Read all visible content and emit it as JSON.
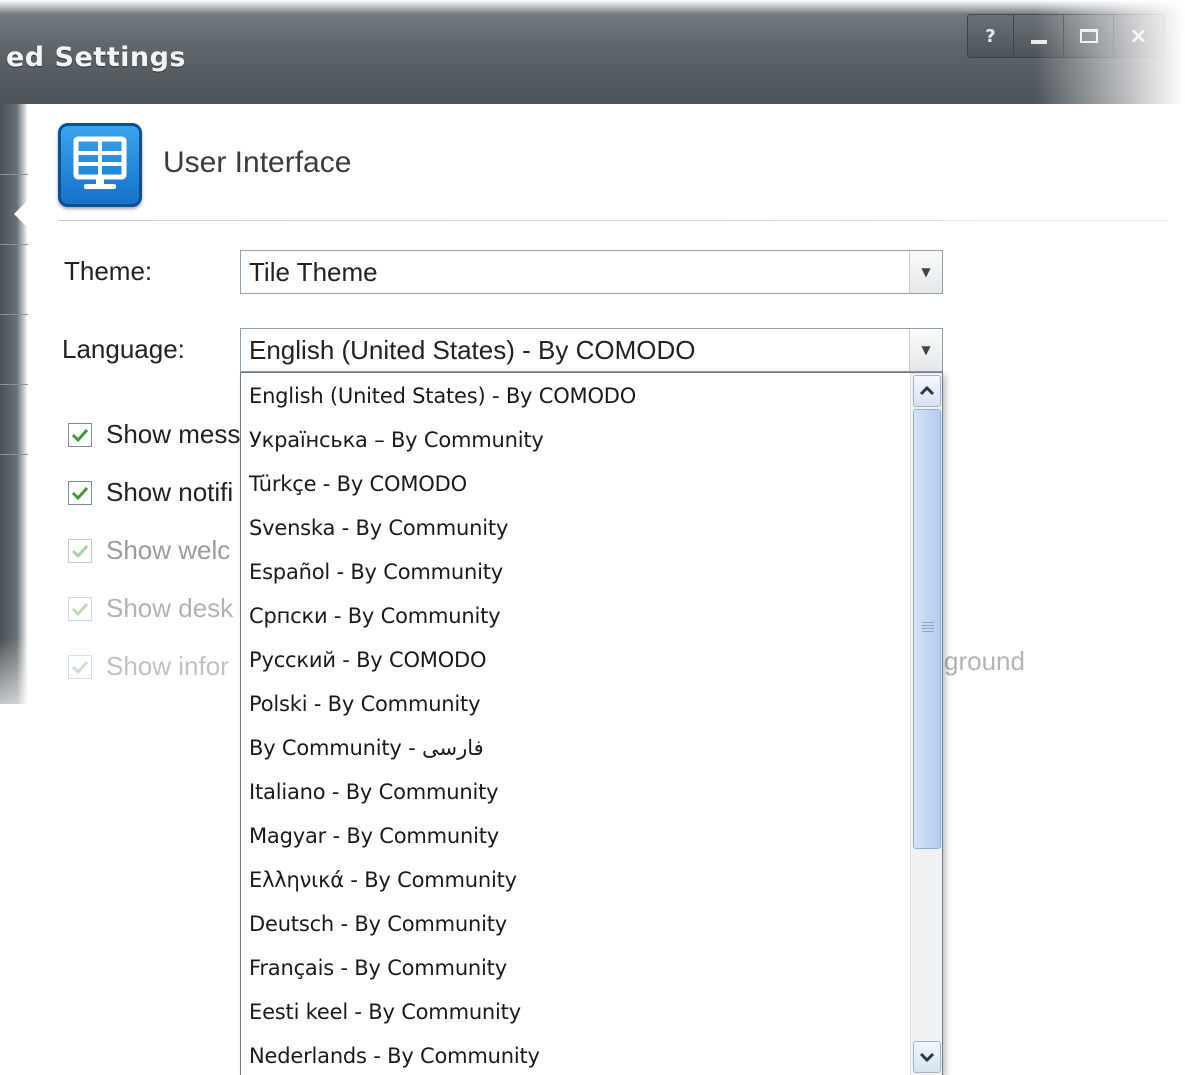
{
  "window": {
    "title": "ed Settings",
    "help_label": "?",
    "close_label": "×"
  },
  "section": {
    "title": "User Interface",
    "icon": "monitor-icon"
  },
  "form": {
    "theme_label": "Theme:",
    "theme_value": "Tile Theme",
    "language_label": "Language:",
    "language_value": "English (United States) - By COMODO"
  },
  "checkboxes": [
    {
      "label": "Show mess",
      "checked": true
    },
    {
      "label": "Show notifi",
      "checked": true
    },
    {
      "label": "Show welc",
      "checked": true
    },
    {
      "label": "Show desk",
      "checked": true
    },
    {
      "label": "Show infor",
      "checked": true
    }
  ],
  "background_text_fragment": "ground",
  "language_options": [
    "English (United States) - By COMODO",
    "Українська – By Community",
    "Türkçe - By COMODO",
    "Svenska - By Community",
    "Español - By Community",
    "Српски - By Community",
    "Русский - By COMODO",
    "Polski - By Community",
    "By Community - فارسی",
    "Italiano - By Community",
    "Magyar - By Community",
    "Ελληνικά - By Community",
    "Deutsch - By Community",
    "Français - By Community",
    "Eesti keel - By Community",
    "Nederlands - By Community"
  ],
  "colors": {
    "titlebar": "#5f666b",
    "icon_blue": "#1e88dc",
    "check_green": "#3d9b35",
    "scroll_thumb": "#c3d7f2"
  }
}
